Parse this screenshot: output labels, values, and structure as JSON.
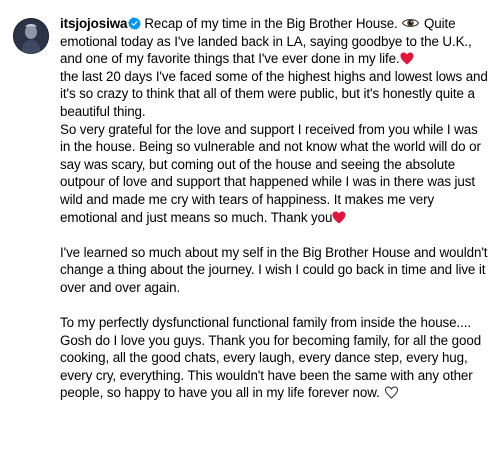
{
  "post": {
    "username": "itsjojosiwa",
    "icons": {
      "avatar": "profile-avatar",
      "verified": "verified-badge-icon",
      "eye": "eye-emoji-icon",
      "heart": "red-heart-emoji-icon",
      "heart_outline": "white-heart-emoji-icon"
    },
    "colors": {
      "verified": "#0095f6",
      "heart": "#e0163c"
    },
    "caption": {
      "p1_a": "Recap of my time in the Big Brother House.",
      "p1_b": "Quite emotional today as I've landed back in LA, saying goodbye to the U.K., and one of my favorite things that I've ever done in my life.",
      "p1_c": "the last 20 days I've faced some of the highest highs and lowest lows and it's so crazy to think that all of them were public, but it's honestly quite a beautiful thing.",
      "p2": "So very grateful for the love and support I received from you while I was in the house. Being so vulnerable and not know what the world will do or say was scary, but coming out of the house and seeing the absolute outpour of love and support that happened while I was in there was just wild and made me cry with tears of happiness. It makes me very emotional and just means so much. Thank you",
      "p3": "I've learned so much about my self in the Big Brother House and wouldn't change a thing about the journey. I wish I could go back in time and live it over and over again.",
      "p4": "To my perfectly dysfunctional functional family from inside the house.... Gosh do I love you guys. Thank you for becoming family, for all the good cooking, all the good chats, every laugh, every dance step, every hug, every cry, everything. This wouldn't have been the same with any other people, so happy to have you all in my life forever now."
    }
  }
}
